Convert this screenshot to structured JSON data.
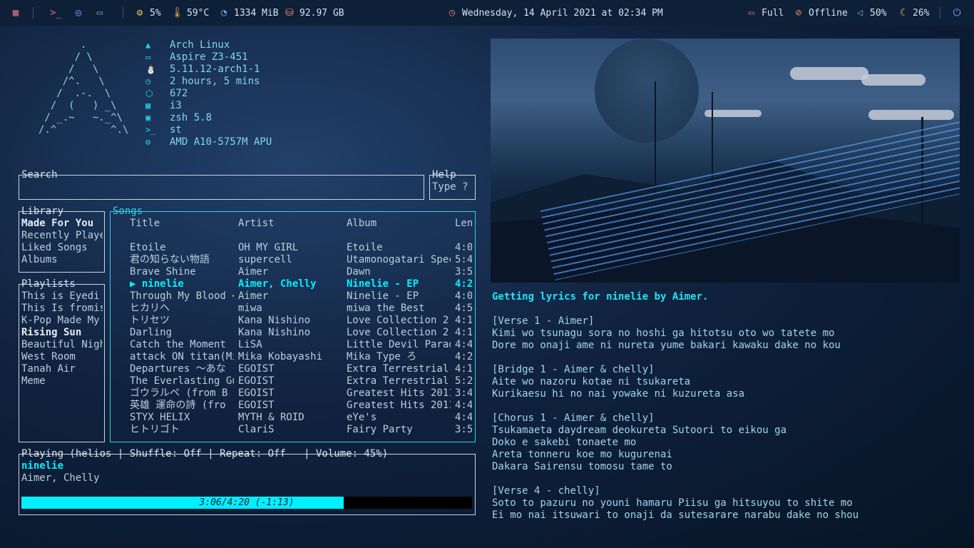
{
  "topbar": {
    "cpu": "5%",
    "temp": "59°C",
    "memory": "1334 MiB",
    "disk": "92.97 GB",
    "datetime": "Wednesday, 14 April 2021 at 02:34 PM",
    "battery": "Full",
    "network": "Offline",
    "volume": "50%",
    "brightness": "26%"
  },
  "neofetch": {
    "logo": [
      "       .",
      "      / \\",
      "     /   \\",
      "    /^.   \\",
      "   /  .-.  \\",
      "  /  (   ) _\\",
      " / _.~   ~._^\\",
      "/.^         ^.\\"
    ],
    "lines": [
      {
        "icon": "arch-icon",
        "glyph": "▲",
        "text": "Arch Linux"
      },
      {
        "icon": "laptop-icon",
        "glyph": "▭",
        "text": "Aspire Z3-451"
      },
      {
        "icon": "linux-icon",
        "glyph": "⛄",
        "text": "5.11.12-arch1-1"
      },
      {
        "icon": "clock-icon",
        "glyph": "◷",
        "text": "2 hours, 5 mins"
      },
      {
        "icon": "package-icon",
        "glyph": "⬡",
        "text": "672"
      },
      {
        "icon": "windows-icon",
        "glyph": "▦",
        "text": "i3"
      },
      {
        "icon": "terminal-icon",
        "glyph": "▣",
        "text": "zsh 5.8"
      },
      {
        "icon": "prompt-icon",
        "glyph": ">_",
        "text": "st"
      },
      {
        "icon": "chip-icon",
        "glyph": "⚙",
        "text": "AMD A10-5757M APU"
      }
    ]
  },
  "search": {
    "label": "Search",
    "value": ""
  },
  "help": {
    "label": "Help",
    "text": "Type ?"
  },
  "library": {
    "label": "Library",
    "items": [
      "Made For You",
      "Recently Playe",
      "Liked Songs",
      "Albums"
    ],
    "active": 0
  },
  "playlists": {
    "label": "Playlists",
    "items": [
      "This is Eyedi",
      "This Is fromis",
      "K-Pop Made My",
      "Rising Sun",
      "Beautiful Nigh",
      "West Room",
      "Tanah Air",
      "Meme"
    ],
    "active": 3
  },
  "songs": {
    "label": "Songs",
    "headers": [
      "Title",
      "Artist",
      "Album",
      "Len"
    ],
    "rows": [
      [
        "Etoile",
        "OH MY GIRL",
        "Etoile",
        "4:0"
      ],
      [
        "君の知らない物語",
        "supercell",
        "Utamonogatari Spec",
        "5:4"
      ],
      [
        "Brave Shine",
        "Aimer",
        "Dawn",
        "3:5"
      ],
      [
        "▶ ninelie",
        "Aimer, Chelly",
        "Ninelie - EP",
        "4:2"
      ],
      [
        "Through My Blood <",
        "Aimer",
        "Ninelie - EP",
        "4:0"
      ],
      [
        "ヒカリヘ",
        "miwa",
        "miwa the Best",
        "4:5"
      ],
      [
        "トリセツ",
        "Kana Nishino",
        "Love Collection 2",
        "4:1"
      ],
      [
        "Darling",
        "Kana Nishino",
        "Love Collection 2",
        "4:1"
      ],
      [
        "Catch the Moment",
        "LiSA",
        "Little Devil Parad",
        "4:4"
      ],
      [
        "attack ON titan(Mi",
        "Mika Kobayashi",
        "Mika Type ろ",
        "4:2"
      ],
      [
        "Departures ～あな",
        "EGOIST",
        "Extra Terrestrial",
        "4:1"
      ],
      [
        "The Everlasting Gu",
        "EGOIST",
        "Extra Terrestrial",
        "5:2"
      ],
      [
        "ゴウラルペ (from B",
        "EGOIST",
        "Greatest Hits 2011",
        "3:4"
      ],
      [
        "英雄 運命の詩 (fro",
        "EGOIST",
        "Greatest Hits 2011",
        "4:4"
      ],
      [
        "STYX HELIX",
        "MYTH & ROID",
        "eYe's",
        "4:4"
      ],
      [
        "ヒトリゴト",
        "ClariS",
        "Fairy Party",
        "3:5"
      ]
    ],
    "active": 3
  },
  "playing": {
    "label": "Playing (helios | Shuffle: Off | Repeat: Off   | Volume: 45%)",
    "title": "ninelie",
    "artist": "Aimer, Chelly",
    "progress_text": "3:06/4:20 (-1:13)",
    "progress": 0.715
  },
  "lyrics": {
    "header": "Getting lyrics for ninelie by Aimer.",
    "lines": [
      "",
      "[Verse 1 - Aimer]",
      "Kimi wo tsunagu sora no hoshi ga hitotsu oto wo tatete mo",
      "Dore mo onaji ame ni nureta yume bakari kawaku dake no kou",
      "",
      "[Bridge 1 - Aimer & chelly]",
      "Aite wo nazoru kotae ni tsukareta",
      "Kurikaesu hi no nai yowake ni kuzureta asa",
      "",
      "[Chorus 1 - Aimer & chelly]",
      "Tsukamaeta daydream deokureta Sutoori to eikou ga",
      "Doko e sakebi tonaete mo",
      "Areta tonneru koe mo kugurenai",
      "Dakara Sairensu tomosu tame to",
      "",
      "[Verse 4 - chelly]",
      "Soto to pazuru no youni hamaru Piisu ga hitsuyou to shite mo",
      "Ei mo nai itsuwari to onaji da sutesarare narabu dake no shou"
    ]
  },
  "colors": {
    "accent": "#00f0ff",
    "bar": "#0d2038",
    "border": "#c6d6e2"
  }
}
